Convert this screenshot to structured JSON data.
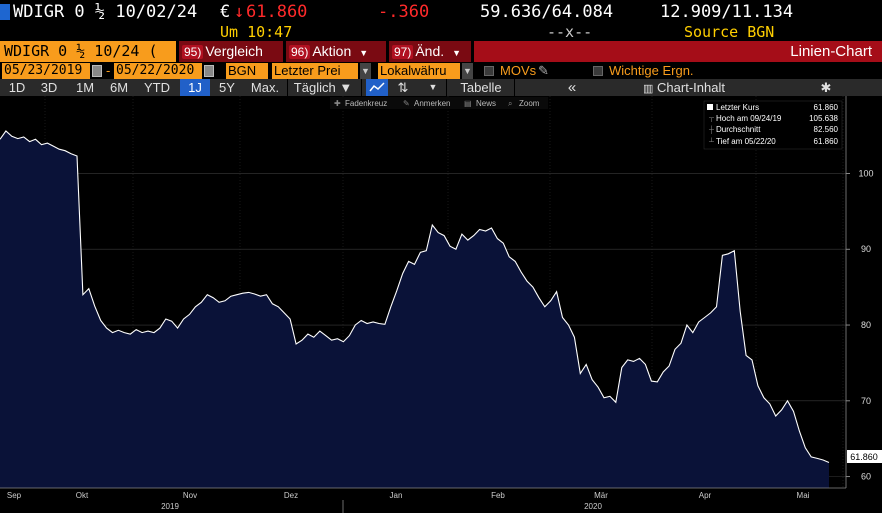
{
  "quote": {
    "ticker": "WDIGR 0 ½ 10/02/24",
    "currency": "€",
    "last_price": "61.860",
    "change": "-.360",
    "bid_ask": "59.636/64.084",
    "yields": "12.909/11.134",
    "time_label": "Um 10:47",
    "dashes": "--x--",
    "source": "Source BGN"
  },
  "toolbar": {
    "ticker_short": "WDIGR 0 ½ 10/24 (",
    "vergleich_num": "95)",
    "vergleich_label": "Vergleich",
    "aktion_num": "96)",
    "aktion_label": "Aktion",
    "aend_num": "97)",
    "aend_label": "Änd.",
    "title": "Linien-Chart"
  },
  "settings": {
    "start_date": "05/23/2019",
    "end_date": "05/22/2020",
    "source": "BGN",
    "price_field": "Letzter Prei",
    "currency_mode": "Lokalwähru",
    "movs_label": "MOVs",
    "events_label": "Wichtige Ergn."
  },
  "periods": {
    "items": [
      "1D",
      "3D",
      "1M",
      "6M",
      "YTD",
      "1J",
      "5Y",
      "Max."
    ],
    "active": "1J",
    "frequency": "Täglich ▼",
    "table_label": "Tabelle",
    "collapse": "«",
    "content_label": "Chart-Inhalt",
    "gear": "✱"
  },
  "tools": {
    "crosshair": "Fadenkreuz",
    "annotate": "Anmerken",
    "news": "News",
    "zoom": "Zoom"
  },
  "legend": {
    "rows": [
      {
        "label": "Letzter Kurs",
        "value": "61.860"
      },
      {
        "label": "Hoch am 09/24/19",
        "value": "105.638"
      },
      {
        "label": "Durchschnitt",
        "value": "82.560"
      },
      {
        "label": "Tief am 05/22/20",
        "value": "61.860"
      }
    ]
  },
  "colors": {
    "accent_orange": "#f89c1c",
    "area_fill": "#0a1238",
    "line": "#ffffff",
    "negative": "#ff2a2a"
  },
  "chart_data": {
    "type": "area",
    "y_ticks": [
      60,
      70,
      80,
      90,
      100
    ],
    "ylim": [
      58.5,
      108.5
    ],
    "last_value_tag": "61.860",
    "x_month_labels": [
      "Sep",
      "Okt",
      "Nov",
      "Dez",
      "Jan",
      "Feb",
      "Mär",
      "Apr",
      "Mai"
    ],
    "x_year_labels": [
      "2019",
      "2020"
    ],
    "series": [
      {
        "values": [
          104.5,
          105.6,
          104.9,
          104.6,
          104.8,
          104.2,
          104.5,
          103.8,
          104.0,
          103.6,
          103.2,
          103.0,
          102.6,
          102.3,
          84.0,
          84.8,
          82.5,
          80.6,
          79.6,
          79.0,
          79.3,
          79.0,
          78.8,
          79.4,
          79.0,
          79.2,
          79.0,
          79.6,
          80.8,
          80.5,
          79.6,
          80.8,
          81.4,
          82.4,
          83.0,
          84.0,
          83.6,
          83.0,
          83.2,
          83.8,
          84.0,
          84.2,
          84.3,
          84.1,
          83.8,
          84.0,
          82.8,
          82.4,
          81.6,
          80.8,
          77.5,
          78.0,
          78.8,
          78.4,
          79.2,
          78.6,
          78.0,
          78.2,
          77.8,
          78.6,
          80.0,
          80.6,
          80.2,
          80.4,
          80.2,
          80.1,
          82.4,
          84.5,
          86.8,
          88.4,
          88.0,
          89.6,
          89.8,
          93.2,
          92.2,
          91.8,
          90.4,
          90.0,
          92.0,
          91.2,
          91.8,
          92.6,
          92.4,
          92.8,
          91.4,
          90.8,
          89.0,
          88.4,
          87.0,
          85.8,
          85.0,
          83.6,
          82.4,
          83.2,
          84.4,
          81.0,
          80.0,
          78.4,
          73.6,
          74.8,
          72.8,
          71.8,
          70.4,
          70.6,
          69.8,
          74.4,
          75.4,
          75.2,
          75.6,
          74.8,
          72.6,
          72.5,
          73.8,
          74.6,
          76.8,
          77.6,
          80.0,
          79.0,
          80.4,
          81.0,
          81.6,
          82.4,
          89.2,
          89.4,
          89.8,
          81.8,
          76.0,
          75.4,
          72.0,
          70.4,
          69.6,
          68.0,
          68.8,
          70.0,
          68.6,
          66.0,
          63.8,
          62.6,
          62.4,
          62.2,
          61.86
        ]
      }
    ]
  }
}
